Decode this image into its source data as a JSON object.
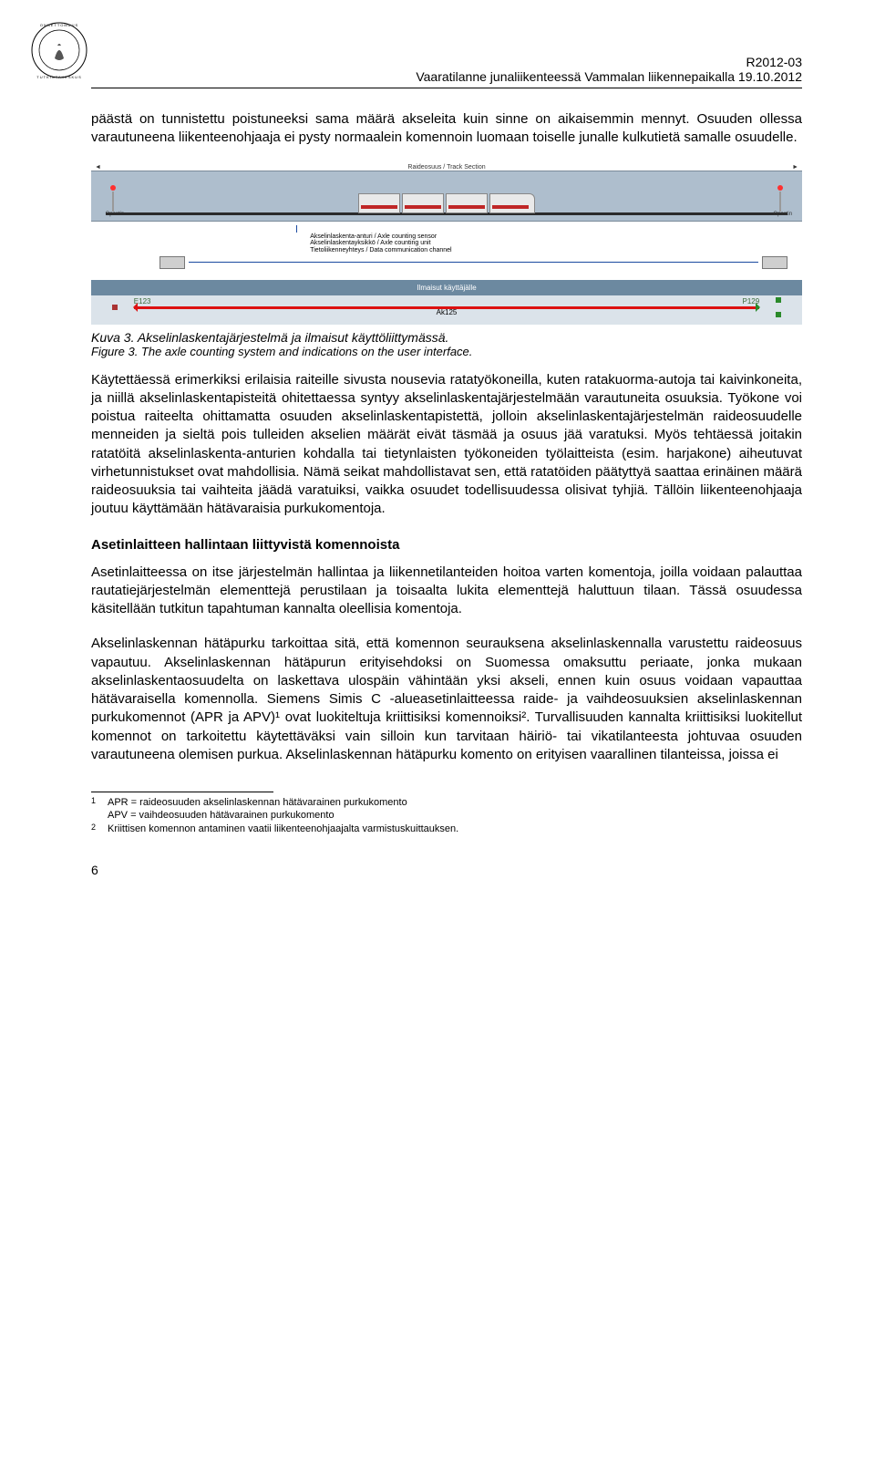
{
  "header": {
    "doc_id": "R2012-03",
    "doc_title": "Vaaratilanne junaliikenteessä Vammalan liikennepaikalla 19.10.2012"
  },
  "para1": "päästä on tunnistettu poistuneeksi sama määrä akseleita kuin sinne on aikaisemmin mennyt. Osuuden ollessa varautuneena liikenteenohjaaja ei pysty normaalein komennoin luomaan toiselle junalle kulkutietä samalle osuudelle.",
  "figure": {
    "top_left": "",
    "track_section": "Raideosuus / Track Section",
    "signal_label": "Opastin",
    "sensor": "Akselinlaskenta-anturi / Axle counting sensor",
    "unit": "Akselinlaskentayksikkö / Axle counting unit",
    "channel": "Tietoliikenneyhteys / Data communication channel",
    "notice": "Ilmaisut käyttäjälle",
    "e_label": "E123",
    "ak_label": "Ak125",
    "p_label": "P129"
  },
  "caption_fi": "Kuva 3.  Akselinlaskentajärjestelmä ja ilmaisut käyttöliittymässä.",
  "caption_en": "Figure 3.  The axle counting system and indications on the user interface.",
  "para2": "Käytettäessä erimerkiksi erilaisia raiteille sivusta nousevia ratatyökoneilla, kuten ratakuorma-autoja tai kaivinkoneita, ja niillä akselinlaskentapisteitä ohitettaessa syntyy akselinlaskentajärjestelmään varautuneita osuuksia. Työkone voi poistua raiteelta ohittamatta osuuden akselinlaskentapistettä, jolloin akselinlaskentajärjestelmän raideosuudelle menneiden ja sieltä pois tulleiden akselien määrät eivät täsmää ja osuus jää varatuksi. Myös tehtäessä joitakin ratatöitä akselinlaskenta-anturien kohdalla tai tietynlaisten työkoneiden työlaitteista (esim. harjakone) aiheutuvat virhetunnistukset ovat mahdollisia. Nämä seikat mahdollistavat sen, että ratatöiden päätyttyä saattaa erinäinen määrä raideosuuksia tai vaihteita jäädä varatuiksi, vaikka osuudet todellisuudessa olisivat tyhjiä. Tällöin liikenteenohjaaja joutuu käyttämään hätävaraisia purkukomentoja.",
  "heading": "Asetinlaitteen hallintaan liittyvistä komennoista",
  "para3": "Asetinlaitteessa on itse järjestelmän hallintaa ja liikennetilanteiden hoitoa varten komentoja, joilla voidaan palauttaa rautatiejärjestelmän elementtejä perustilaan ja toisaalta lukita elementtejä haluttuun tilaan. Tässä osuudessa käsitellään tutkitun tapahtuman kannalta oleellisia komentoja.",
  "para4": "Akselinlaskennan hätäpurku tarkoittaa sitä, että komennon seurauksena akselinlaskennalla varustettu raideosuus vapautuu. Akselinlaskennan hätäpurun erityisehdoksi on Suomessa omaksuttu periaate, jonka mukaan akselinlaskentaosuudelta on laskettava ulospäin vähintään yksi akseli, ennen kuin osuus voidaan vapauttaa hätävaraisella komennolla. Siemens Simis C -alueasetinlaitteessa raide- ja vaihdeosuuksien akselinlaskennan purkukomennot (APR ja APV)¹ ovat luokiteltuja kriittisiksi komennoiksi². Turvallisuuden kannalta kriittisiksi luokitellut komennot on tarkoitettu käytettäväksi vain silloin kun tarvitaan häiriö- tai vikatilanteesta johtuvaa osuuden varautuneena olemisen purkua. Akselinlaskennan hätäpurku komento on erityisen vaarallinen tilanteissa, joissa ei",
  "footnotes": {
    "f1a": "APR = raideosuuden akselinlaskennan hätävarainen purkukomento",
    "f1b": "APV = vaihdeosuuden hätävarainen purkukomento",
    "f2": "Kriittisen komennon antaminen vaatii liikenteenohjaajalta varmistuskuittauksen."
  },
  "page_number": "6"
}
